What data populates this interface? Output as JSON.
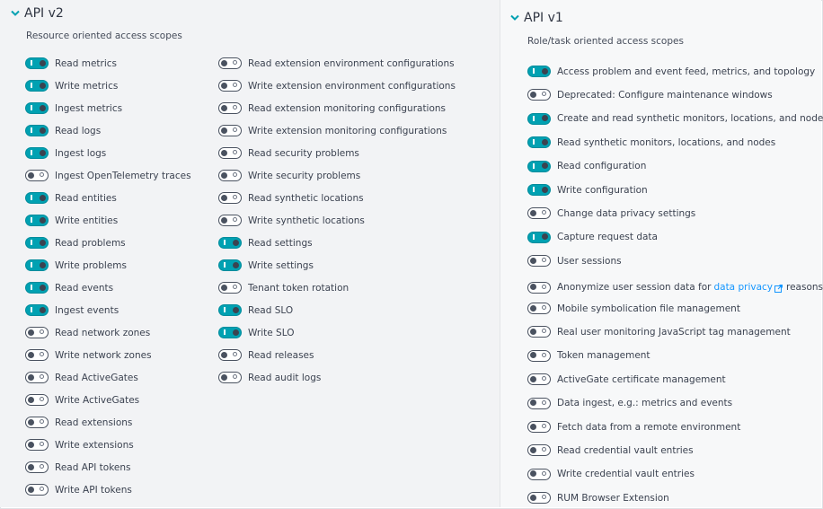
{
  "v2": {
    "title": "API v2",
    "subtitle": "Resource oriented access scopes",
    "col1": [
      {
        "label": "Read metrics",
        "on": true
      },
      {
        "label": "Write metrics",
        "on": true
      },
      {
        "label": "Ingest metrics",
        "on": true
      },
      {
        "label": "Read logs",
        "on": true
      },
      {
        "label": "Ingest logs",
        "on": true
      },
      {
        "label": "Ingest OpenTelemetry traces",
        "on": false
      },
      {
        "label": "Read entities",
        "on": true
      },
      {
        "label": "Write entities",
        "on": true
      },
      {
        "label": "Read problems",
        "on": true
      },
      {
        "label": "Write problems",
        "on": true
      },
      {
        "label": "Read events",
        "on": true
      },
      {
        "label": "Ingest events",
        "on": true
      },
      {
        "label": "Read network zones",
        "on": false
      },
      {
        "label": "Write network zones",
        "on": false
      },
      {
        "label": "Read ActiveGates",
        "on": false
      },
      {
        "label": "Write ActiveGates",
        "on": false
      },
      {
        "label": "Read extensions",
        "on": false
      },
      {
        "label": "Write extensions",
        "on": false
      },
      {
        "label": "Read API tokens",
        "on": false
      },
      {
        "label": "Write API tokens",
        "on": false
      }
    ],
    "col2": [
      {
        "label": "Read extension environment configurations",
        "on": false
      },
      {
        "label": "Write extension environment configurations",
        "on": false
      },
      {
        "label": "Read extension monitoring configurations",
        "on": false
      },
      {
        "label": "Write extension monitoring configurations",
        "on": false
      },
      {
        "label": "Read security problems",
        "on": false
      },
      {
        "label": "Write security problems",
        "on": false
      },
      {
        "label": "Read synthetic locations",
        "on": false
      },
      {
        "label": "Write synthetic locations",
        "on": false
      },
      {
        "label": "Read settings",
        "on": true
      },
      {
        "label": "Write settings",
        "on": true
      },
      {
        "label": "Tenant token rotation",
        "on": false
      },
      {
        "label": "Read SLO",
        "on": true
      },
      {
        "label": "Write SLO",
        "on": true
      },
      {
        "label": "Read releases",
        "on": false
      },
      {
        "label": "Read audit logs",
        "on": false
      }
    ]
  },
  "v1": {
    "title": "API v1",
    "subtitle": "Role/task oriented access scopes",
    "items": [
      {
        "label": "Access problem and event feed, metrics, and topology",
        "on": true
      },
      {
        "label": "Deprecated: Configure maintenance windows",
        "on": false
      },
      {
        "label": "Create and read synthetic monitors, locations, and nodes",
        "on": true
      },
      {
        "label": "Read synthetic monitors, locations, and nodes",
        "on": true
      },
      {
        "label": "Read configuration",
        "on": true
      },
      {
        "label": "Write configuration",
        "on": true
      },
      {
        "label": "Change data privacy settings",
        "on": false
      },
      {
        "label": "Capture request data",
        "on": true
      },
      {
        "label": "User sessions",
        "on": false
      },
      {
        "label": "Anonymize user session data for",
        "on": false,
        "link": "data privacy",
        "tail": "reasons"
      },
      {
        "label": "Mobile symbolication file management",
        "on": false
      },
      {
        "label": "Real user monitoring JavaScript tag management",
        "on": false
      },
      {
        "label": "Token management",
        "on": false
      },
      {
        "label": "ActiveGate certificate management",
        "on": false
      },
      {
        "label": "Data ingest, e.g.: metrics and events",
        "on": false
      },
      {
        "label": "Fetch data from a remote environment",
        "on": false
      },
      {
        "label": "Read credential vault entries",
        "on": false
      },
      {
        "label": "Write credential vault entries",
        "on": false
      },
      {
        "label": "RUM Browser Extension",
        "on": false
      }
    ]
  },
  "colors": {
    "accent": "#00a1b2",
    "link": "#1496ff"
  },
  "icons": {
    "chevron": "chevron-down-icon",
    "external": "external-link-icon"
  }
}
